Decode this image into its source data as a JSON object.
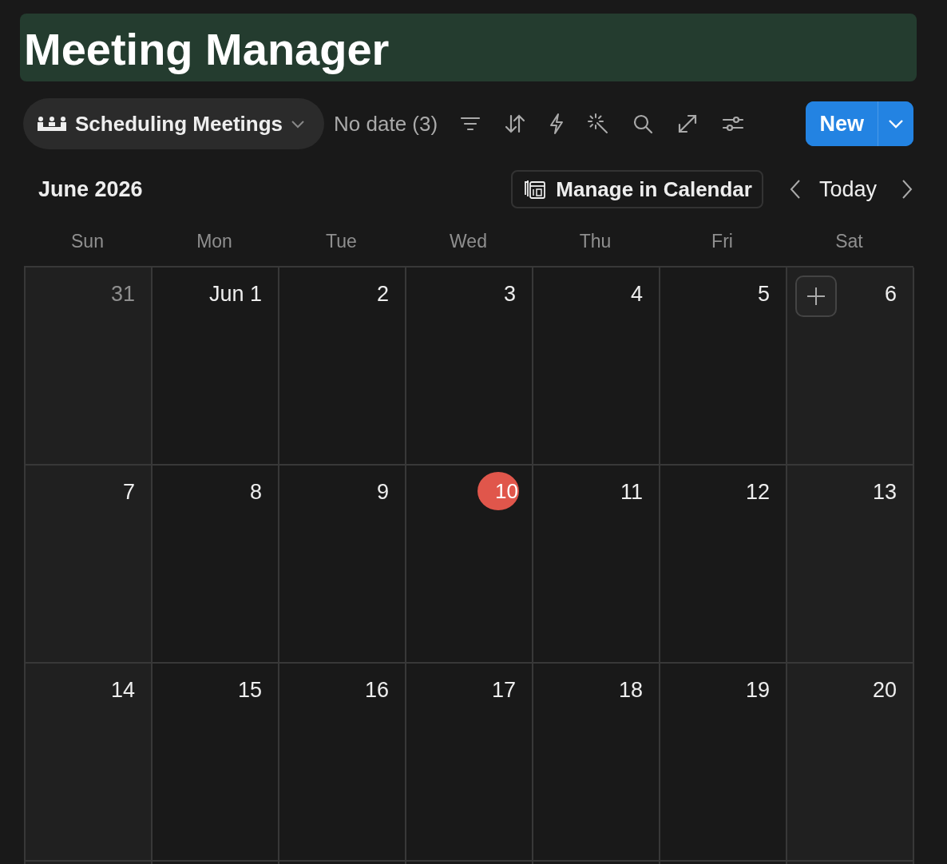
{
  "title": "Meeting Manager",
  "toolbar": {
    "view": {
      "label": "Scheduling Meetings"
    },
    "no_date": "No date (3)",
    "new_button": "New"
  },
  "calendar": {
    "month": "June 2026",
    "manage_button": "Manage in Calendar",
    "today_button": "Today",
    "weekdays": [
      {
        "label": "Sun",
        "weekend": true
      },
      {
        "label": "Mon",
        "weekend": false
      },
      {
        "label": "Tue",
        "weekend": false
      },
      {
        "label": "Wed",
        "weekend": false
      },
      {
        "label": "Thu",
        "weekend": false
      },
      {
        "label": "Fri",
        "weekend": false
      },
      {
        "label": "Sat",
        "weekend": true
      }
    ],
    "weeks": [
      [
        {
          "label": "31",
          "outside": true,
          "today": false,
          "hovered": false
        },
        {
          "label": "Jun 1",
          "outside": false,
          "today": false,
          "hovered": false
        },
        {
          "label": "2",
          "outside": false,
          "today": false,
          "hovered": false
        },
        {
          "label": "3",
          "outside": false,
          "today": false,
          "hovered": false
        },
        {
          "label": "4",
          "outside": false,
          "today": false,
          "hovered": false
        },
        {
          "label": "5",
          "outside": false,
          "today": false,
          "hovered": false
        },
        {
          "label": "6",
          "outside": false,
          "today": false,
          "hovered": true
        }
      ],
      [
        {
          "label": "7",
          "outside": false,
          "today": false,
          "hovered": false
        },
        {
          "label": "8",
          "outside": false,
          "today": false,
          "hovered": false
        },
        {
          "label": "9",
          "outside": false,
          "today": false,
          "hovered": false
        },
        {
          "label": "10",
          "outside": false,
          "today": true,
          "hovered": false
        },
        {
          "label": "11",
          "outside": false,
          "today": false,
          "hovered": false
        },
        {
          "label": "12",
          "outside": false,
          "today": false,
          "hovered": false
        },
        {
          "label": "13",
          "outside": false,
          "today": false,
          "hovered": false
        }
      ],
      [
        {
          "label": "14",
          "outside": false,
          "today": false,
          "hovered": false
        },
        {
          "label": "15",
          "outside": false,
          "today": false,
          "hovered": false
        },
        {
          "label": "16",
          "outside": false,
          "today": false,
          "hovered": false
        },
        {
          "label": "17",
          "outside": false,
          "today": false,
          "hovered": false
        },
        {
          "label": "18",
          "outside": false,
          "today": false,
          "hovered": false
        },
        {
          "label": "19",
          "outside": false,
          "today": false,
          "hovered": false
        },
        {
          "label": "20",
          "outside": false,
          "today": false,
          "hovered": false
        }
      ]
    ]
  }
}
